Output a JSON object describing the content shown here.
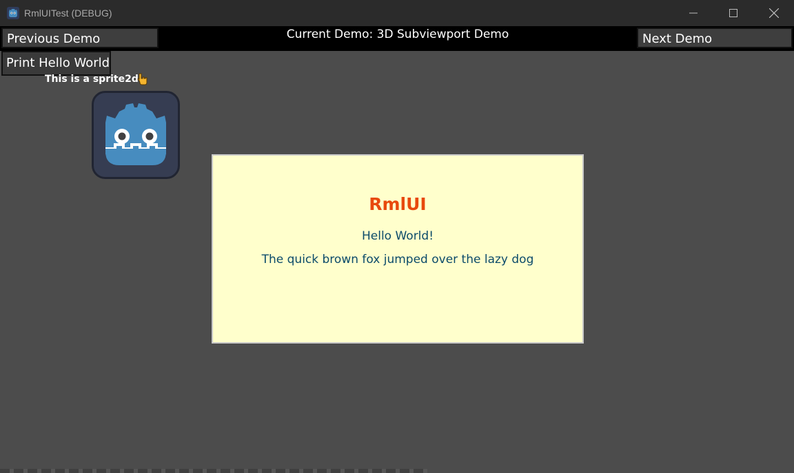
{
  "window": {
    "title": "RmlUITest (DEBUG)",
    "app_icon": "godot-icon",
    "controls": {
      "minimize_icon": "minimize-icon",
      "maximize_icon": "maximize-icon",
      "close_icon": "close-icon"
    }
  },
  "nav": {
    "previous_label": "Previous Demo",
    "current_label": "Current Demo: 3D Subviewport Demo",
    "next_label": "Next Demo"
  },
  "actions": {
    "print_hello_label": "Print Hello World"
  },
  "sprite": {
    "label": "This is a sprite2d",
    "pointer_icon": "pointing-hand-icon",
    "image_icon": "godot-logo-icon"
  },
  "rml_panel": {
    "title": "RmlUI",
    "line1": "Hello World!",
    "line2": "The quick brown fox jumped over the lazy dog"
  },
  "colors": {
    "background": "#4c4c4c",
    "titlebar": "#2b2b2b",
    "navbar": "#000000",
    "panel_background": "#ffffcc",
    "panel_title": "#e8490d",
    "panel_text": "#0c4b6a",
    "godot_blue": "#478cbf"
  }
}
